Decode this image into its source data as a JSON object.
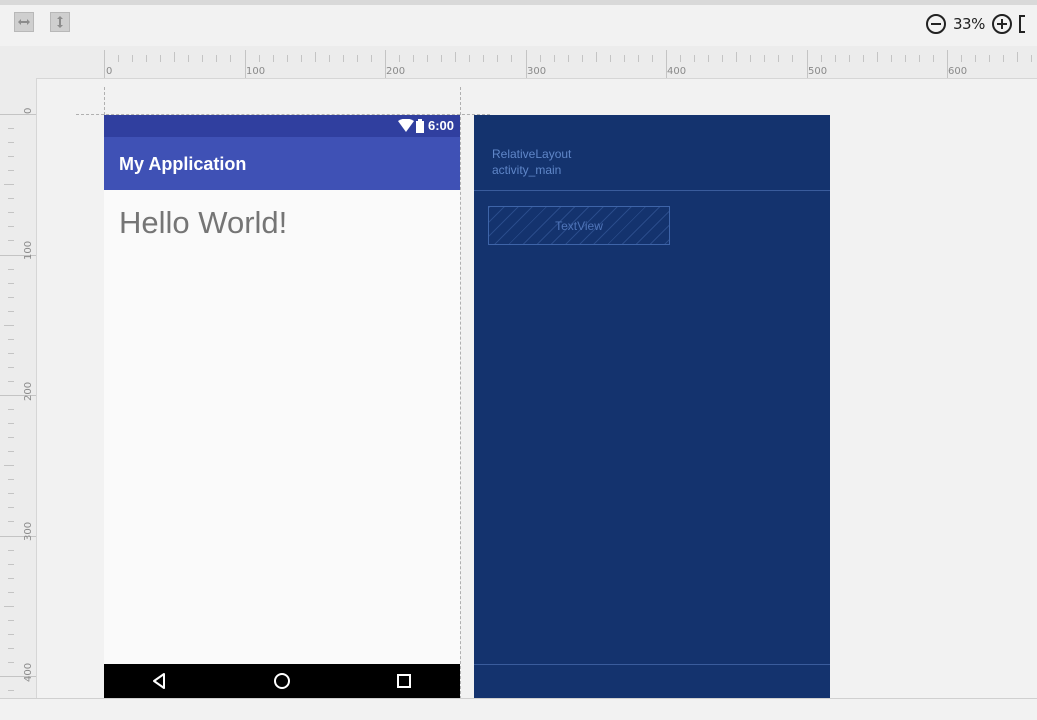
{
  "toolbar": {
    "zoom_label": "33%",
    "icons": [
      "horizontal-resize-icon",
      "vertical-resize-icon",
      "zoom-out-icon",
      "zoom-in-icon"
    ]
  },
  "ruler": {
    "top_ticks": [
      "0",
      "100",
      "200",
      "300",
      "400",
      "500",
      "600"
    ],
    "left_ticks": [
      "0",
      "100",
      "200",
      "300",
      "400"
    ]
  },
  "phone": {
    "status_time": "6:00",
    "app_title": "My Application",
    "hello_text": "Hello World!",
    "colors": {
      "status_bar": "#303f9f",
      "app_bar": "#3f51b5",
      "nav_bar": "#000000"
    }
  },
  "blueprint": {
    "layout_type": "RelativeLayout",
    "layout_id": "activity_main",
    "textview_label": "TextView",
    "background": "#14336e"
  }
}
